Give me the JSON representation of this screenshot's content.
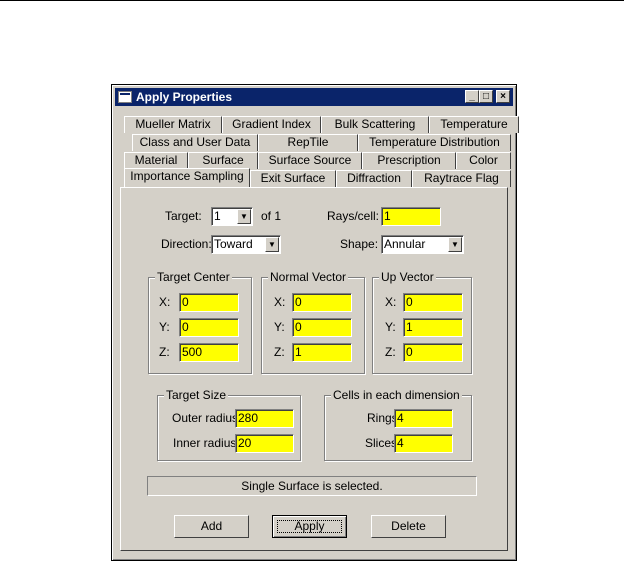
{
  "window": {
    "title": "Apply Properties",
    "controls": {
      "minimize": "_",
      "maximize": "□",
      "close": "×"
    }
  },
  "tabs": {
    "row1": [
      "Mueller Matrix",
      "Gradient Index",
      "Bulk Scattering",
      "Temperature"
    ],
    "row2": [
      "Class and User Data",
      "RepTile",
      "Temperature Distribution"
    ],
    "row3": [
      "Material",
      "Surface",
      "Surface Source",
      "Prescription",
      "Color"
    ],
    "row4": [
      "Importance Sampling",
      "Exit Surface",
      "Diffraction",
      "Raytrace Flag"
    ],
    "active": "Importance Sampling"
  },
  "form": {
    "target_label": "Target:",
    "target_value": "1",
    "target_of": "of 1",
    "rays_label": "Rays/cell:",
    "rays_value": "1",
    "direction_label": "Direction:",
    "direction_value": "Toward",
    "shape_label": "Shape:",
    "shape_value": "Annular"
  },
  "target_center": {
    "title": "Target Center",
    "x_label": "X:",
    "x": "0",
    "y_label": "Y:",
    "y": "0",
    "z_label": "Z:",
    "z": "500"
  },
  "normal_vector": {
    "title": "Normal Vector",
    "x_label": "X:",
    "x": "0",
    "y_label": "Y:",
    "y": "0",
    "z_label": "Z:",
    "z": "1"
  },
  "up_vector": {
    "title": "Up Vector",
    "x_label": "X:",
    "x": "0",
    "y_label": "Y:",
    "y": "1",
    "z_label": "Z:",
    "z": "0"
  },
  "target_size": {
    "title": "Target Size",
    "outer_label": "Outer radius:",
    "outer": "280",
    "inner_label": "Inner radius:",
    "inner": "20"
  },
  "cells": {
    "title": "Cells in each dimension",
    "rings_label": "Rings:",
    "rings": "4",
    "slices_label": "Slices:",
    "slices": "4"
  },
  "status": "Single Surface is selected.",
  "buttons": {
    "add": "Add",
    "apply": "Apply",
    "delete": "Delete"
  },
  "colors": {
    "field_bg": "#ffff00",
    "titlebar": "#0a246a",
    "dialog_bg": "#d4d0c8"
  }
}
